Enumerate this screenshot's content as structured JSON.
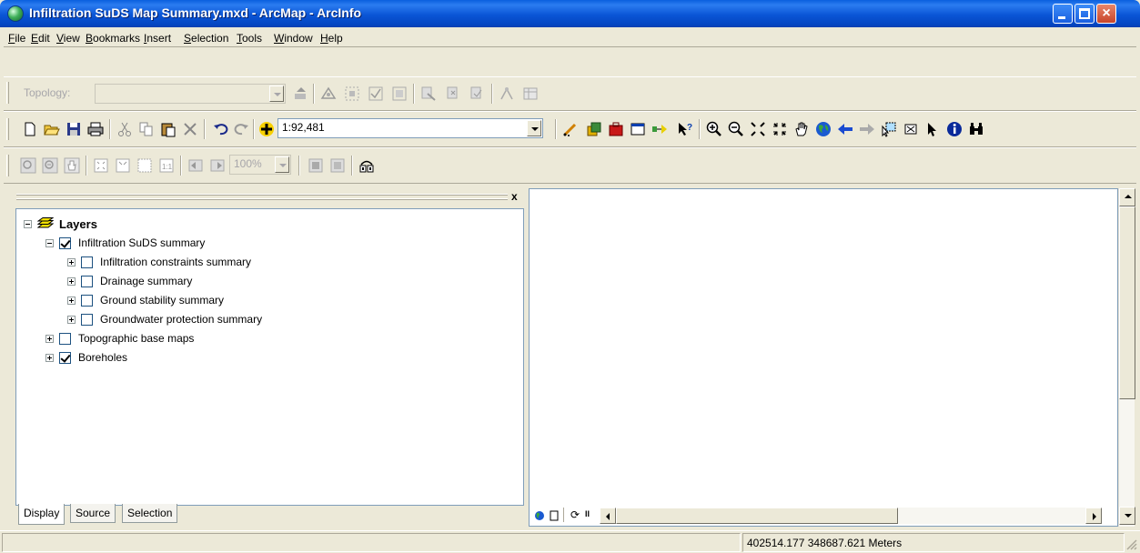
{
  "window": {
    "title": "Infiltration SuDS Map Summary.mxd - ArcMap - ArcInfo",
    "close_glyph": "×"
  },
  "menu": [
    "File",
    "Edit",
    "View",
    "Bookmarks",
    "Insert",
    "Selection",
    "Tools",
    "Window",
    "Help"
  ],
  "topology_toolbar": {
    "label": "Topology:",
    "value": ""
  },
  "standard_toolbar": {
    "scale_value": "1:92,481"
  },
  "layout_toolbar": {
    "zoom_value": "100%"
  },
  "toc": {
    "close_glyph": "x",
    "root": "Layers",
    "layers": [
      {
        "label": "Infiltration SuDS summary",
        "checked": true,
        "expanded": true,
        "level": 1
      },
      {
        "label": "Infiltration constraints summary",
        "checked": false,
        "expanded": false,
        "level": 2
      },
      {
        "label": "Drainage summary",
        "checked": false,
        "expanded": false,
        "level": 2
      },
      {
        "label": "Ground stability summary",
        "checked": false,
        "expanded": false,
        "level": 2
      },
      {
        "label": "Groundwater protection summary",
        "checked": false,
        "expanded": false,
        "level": 2
      },
      {
        "label": "Topographic base maps",
        "checked": false,
        "expanded": false,
        "level": 1
      },
      {
        "label": "Boreholes",
        "checked": true,
        "expanded": false,
        "level": 1
      }
    ],
    "tabs": [
      "Display",
      "Source",
      "Selection"
    ],
    "active_tab": "Display"
  },
  "map_view_controls": {
    "refresh_glyph": "⟳",
    "pause_glyph": "II"
  },
  "status_bar": {
    "coordinates": "402514.177  348687.621 Meters"
  },
  "colors": {
    "titlebar": "#0a55d6",
    "chrome": "#ece9d8",
    "border": "#7f9db9"
  }
}
